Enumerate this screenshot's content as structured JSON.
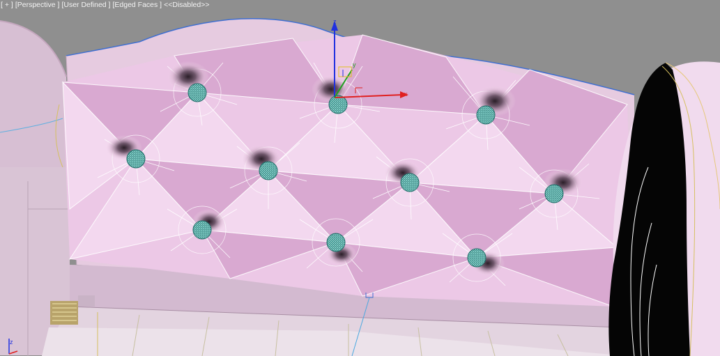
{
  "viewport": {
    "label_parts": [
      "[ + ]",
      "[Perspective ]",
      "[User Defined ]",
      "[Edged Faces ]",
      "<<Disabled>>"
    ],
    "gizmo_axis_x": "x",
    "gizmo_axis_y": "y",
    "gizmo_axis_z": "z",
    "corner_axis_z": "z"
  },
  "colors": {
    "background": "#8f8f8f",
    "headboard_fill": "#eed4e8",
    "headboard_shade": "#d9b3d2",
    "wire_edges": "#ffffff",
    "spline_blue": "#3f6fd1",
    "button_teal": "#2f9a93",
    "gizmo_x": "#e02020",
    "gizmo_y": "#20a020",
    "gizmo_z": "#2030e0"
  },
  "icons": [
    "transform-gizmo-icon",
    "view-axis-tripod-icon",
    "tufted-button-icon"
  ]
}
